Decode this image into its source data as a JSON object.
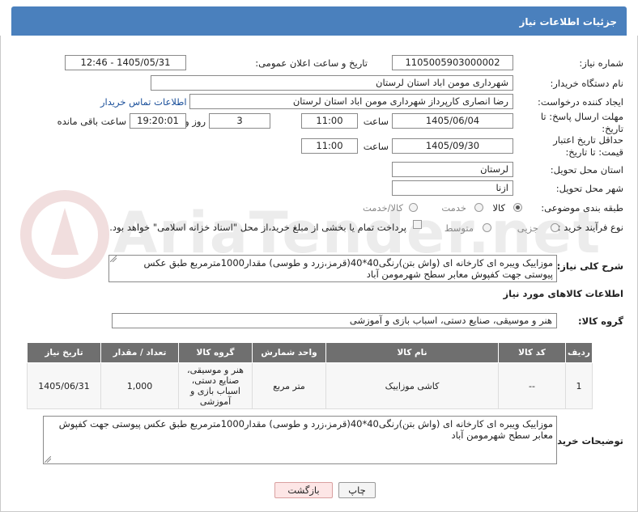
{
  "header": {
    "title": "جزئیات اطلاعات نیاز"
  },
  "watermark": {
    "text": "AriaTender.net"
  },
  "form": {
    "need_number_label": "شماره نیاز:",
    "need_number": "1105005903000002",
    "announce_label": "تاریخ و ساعت اعلان عمومی:",
    "announce_value": "1405/05/31 - 12:46",
    "buyer_label": "نام دستگاه خریدار:",
    "buyer_value": "شهرداری مومن اباد استان لرستان",
    "creator_label": "ایجاد کننده درخواست:",
    "creator_value": "رضا انصاری کارپرداز شهرداری مومن اباد استان لرستان",
    "contact_link": "اطلاعات تماس خریدار",
    "deadline_label": "مهلت ارسال پاسخ: تا تاریخ:",
    "deadline_date": "1405/06/04",
    "time_label": "ساعت",
    "deadline_time": "11:00",
    "days_value": "3",
    "days_label": "روز و",
    "remaining_time": "19:20:01",
    "remaining_label": "ساعت باقی مانده",
    "min_price_label": "حداقل تاریخ اعتبار قیمت: تا تاریخ:",
    "min_price_date": "1405/09/30",
    "min_price_time": "11:00",
    "province_label": "استان محل تحویل:",
    "province_value": "لرستان",
    "city_label": "شهر محل تحویل:",
    "city_value": "ازنا",
    "category_label": "طبقه بندی موضوعی:",
    "category_options": [
      "کالا",
      "خدمت",
      "کالا/خدمت"
    ],
    "category_selected": "کالا",
    "process_label": "نوع فرآیند خرید :",
    "process_options": [
      "جزیی",
      "متوسط"
    ],
    "payment_note": "پرداخت تمام یا بخشی از مبلغ خرید،از محل \"اسناد خزانه اسلامی\" خواهد بود.",
    "summary_label": "شرح کلی نیاز:",
    "summary_value": "موزاییک ویبره ای کارخانه ای (واش بتن)رنگی40*40(قرمز،زرد و طوسی) مقدار1000مترمربع طبق عکس پیوستی جهت کفپوش معابر سطح شهرمومن آباد"
  },
  "goods": {
    "section_title": "اطلاعات کالاهای مورد نیاز",
    "group_label": "گروه کالا:",
    "group_value": "هنر و موسیقی، صنایع دستی، اسباب بازی و آموزشی",
    "columns": [
      "ردیف",
      "کد کالا",
      "نام کالا",
      "واحد شمارش",
      "گروه کالا",
      "تعداد / مقدار",
      "تاریخ نیاز"
    ],
    "rows": [
      {
        "row": "1",
        "code": "--",
        "name": "کاشی موزاییک",
        "unit": "متر مربع",
        "group": "هنر و موسیقی، صنایع دستی، اسباب بازی و آموزشی",
        "qty": "1,000",
        "date": "1405/06/31"
      }
    ]
  },
  "buyer_notes": {
    "label": "توضیحات خریدار:",
    "value": "موزاییک ویبره ای کارخانه ای (واش بتن)رنگی40*40(قرمز،زرد و طوسی) مقدار1000مترمربع طبق عکس پیوستی جهت کفپوش معابر سطح شهرمومن آباد"
  },
  "buttons": {
    "print": "چاپ",
    "back": "بازگشت"
  },
  "colors": {
    "header": "#4a80bd",
    "table_header": "#6f6f6f",
    "link": "#1a4f9a",
    "back_button": "#fde6e6"
  }
}
